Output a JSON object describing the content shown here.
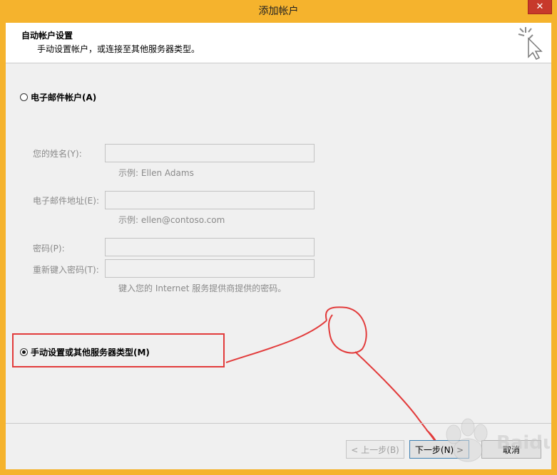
{
  "window": {
    "title": "添加帐户",
    "close_glyph": "✕"
  },
  "header": {
    "title": "自动帐户设置",
    "subtitle": "手动设置帐户，或连接至其他服务器类型。",
    "icon": "sparkle-cursor-icon"
  },
  "options": {
    "email_account": {
      "label": "电子邮件帐户(A)",
      "checked": false
    },
    "manual_setup": {
      "label": "手动设置或其他服务器类型(M)",
      "checked": true
    }
  },
  "form": {
    "name_label": "您的姓名(Y):",
    "name_value": "",
    "name_hint": "示例: Ellen Adams",
    "email_label": "电子邮件地址(E):",
    "email_value": "",
    "email_hint": "示例: ellen@contoso.com",
    "password_label": "密码(P):",
    "password_value": "",
    "retype_label": "重新键入密码(T):",
    "retype_value": "",
    "password_hint": "键入您的 Internet 服务提供商提供的密码。"
  },
  "buttons": {
    "back": "< 上一步(B)",
    "next": "下一步(N) >",
    "cancel": "取消"
  },
  "annotation": {
    "color": "#e23b3b"
  },
  "watermark": {
    "text": "Baidu经验"
  }
}
